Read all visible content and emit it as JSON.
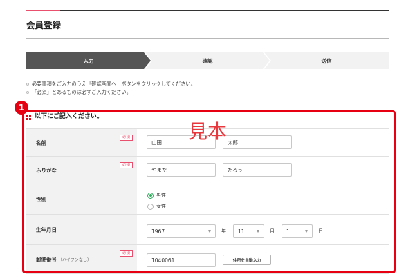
{
  "page": {
    "title": "会員登録"
  },
  "steps": [
    {
      "label": "入力",
      "active": true
    },
    {
      "label": "確認",
      "active": false
    },
    {
      "label": "送信",
      "active": false
    }
  ],
  "notes": [
    "必要事項をご入力のうえ「確認画面へ」ボタンをクリックしてください。",
    "「必須」とあるものは必ずご入力ください。"
  ],
  "annotation": {
    "marker_number": "1",
    "watermark": "見本"
  },
  "form": {
    "heading": "以下にご記入ください。",
    "required_label": "必須",
    "name": {
      "label": "名前",
      "required": true,
      "last_name": "山田",
      "first_name": "太郎"
    },
    "furigana": {
      "label": "ふりがな",
      "required": true,
      "last_name": "やまだ",
      "first_name": "たろう"
    },
    "gender": {
      "label": "性別",
      "options": [
        {
          "label": "男性",
          "checked": true
        },
        {
          "label": "女性",
          "checked": false
        }
      ]
    },
    "birthdate": {
      "label": "生年月日",
      "year": "1967",
      "year_unit": "年",
      "month": "11",
      "month_unit": "月",
      "day": "1",
      "day_unit": "日"
    },
    "postal_code": {
      "label": "郵便番号",
      "sublabel": "（ハイフンなし）",
      "required": true,
      "value": "1040061",
      "autofill_button": "住所を自動入力"
    }
  },
  "icons": {
    "heading_marker": "square-bullet-icon",
    "select_arrow": "chevron-down-icon",
    "note_bullet": "circle-bullet-icon"
  },
  "colors": {
    "accent_red": "#e60012",
    "step_active": "#555555",
    "step_inactive": "#f2f2f2",
    "radio_checked": "#2eaa5c",
    "required": "#e8506e",
    "label_bg": "#f2f2f2",
    "topline_accent": "#e8506e",
    "watermark": "#e8383d"
  }
}
